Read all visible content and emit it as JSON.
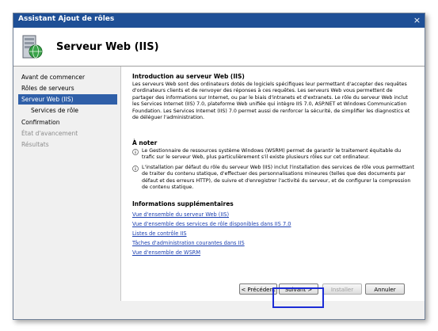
{
  "window": {
    "title": "Assistant Ajout de rôles",
    "close_glyph": "×"
  },
  "header": {
    "title": "Serveur Web (IIS)",
    "icon": "server-icon"
  },
  "nav": {
    "items": [
      {
        "label": "Avant de commencer",
        "state": "normal"
      },
      {
        "label": "Rôles de serveurs",
        "state": "normal"
      },
      {
        "label": "Serveur Web (IIS)",
        "state": "selected"
      },
      {
        "label": "Services de rôle",
        "state": "normal"
      },
      {
        "label": "Confirmation",
        "state": "normal"
      },
      {
        "label": "État d'avancement",
        "state": "disabled"
      },
      {
        "label": "Résultats",
        "state": "disabled"
      }
    ]
  },
  "content": {
    "intro_heading": "Introduction au serveur Web (IIS)",
    "intro_text": "Les serveurs Web sont des ordinateurs dotés de logiciels spécifiques leur permettant d'accepter des requêtes d'ordinateurs clients et de renvoyer des réponses à ces requêtes. Les serveurs Web vous permettent de partager des informations sur Internet, ou par le biais d'intranets et d'extranets. Le rôle du serveur Web inclut les Services Internet (IIS) 7.0, plateforme Web unifiée qui intègre IIS 7.0, ASP.NET et Windows Communication Foundation. Les Services Internet (IIS) 7.0 permet aussi de renforcer la sécurité, de simplifier les diagnostics et de déléguer l'administration.",
    "note_heading": "À noter",
    "notes": [
      "Le Gestionnaire de ressources système Windows (WSRM) permet de garantir le traitement équitable du trafic sur le serveur Web, plus particulièrement s'il existe plusieurs rôles sur cet ordinateur.",
      "L'installation par défaut du rôle du serveur Web (IIS) inclut l'installation des services de rôle vous permettant de traiter du contenu statique, d'effectuer des personnalisations mineures (telles que des documents par défaut et des erreurs HTTP), de suivre et d'enregistrer l'activité du serveur, et de configurer la compression de contenu statique."
    ],
    "info_heading": "Informations supplémentaires",
    "links": [
      "Vue d'ensemble du serveur Web (IIS)",
      "Vue d'ensemble des services de rôle disponibles dans IIS 7.0",
      "Listes de contrôle IIS",
      "Tâches d'administration courantes dans IIS",
      "Vue d'ensemble de WSRM"
    ]
  },
  "buttons": {
    "previous": "< Précédent",
    "next": "Suivant >",
    "install": "Installer",
    "cancel": "Annuler"
  },
  "colors": {
    "titlebar": "#1e4f96",
    "selected_nav": "#2f5fa8",
    "link": "#1b3fb0",
    "highlight_box": "#1c2cd6"
  }
}
